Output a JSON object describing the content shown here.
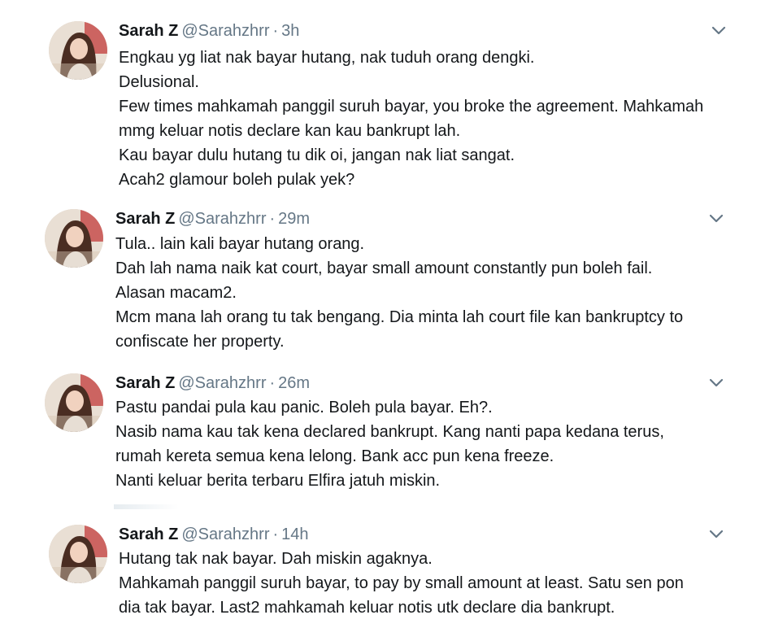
{
  "tweets": [
    {
      "name": "Sarah Z",
      "handle": "@Sarahzhrr",
      "dot": "·",
      "time": "3h",
      "lines": [
        "Engkau yg liat nak bayar hutang, nak tuduh orang dengki.",
        "Delusional.",
        "Few times mahkamah panggil suruh bayar, you broke the agreement. Mahkamah",
        "mmg keluar notis declare kan kau bankrupt lah.",
        "Kau bayar dulu hutang tu dik oi, jangan nak liat sangat.",
        "Acah2 glamour boleh pulak yek?"
      ]
    },
    {
      "name": "Sarah Z",
      "handle": "@Sarahzhrr",
      "dot": "·",
      "time": "29m",
      "lines": [
        "Tula.. lain kali bayar hutang orang.",
        "Dah lah nama naik kat court, bayar small amount constantly  pun boleh fail.",
        "Alasan macam2.",
        "Mcm mana lah orang tu tak bengang. Dia minta lah court file kan bankruptcy to",
        "confiscate her property."
      ]
    },
    {
      "name": "Sarah Z",
      "handle": "@Sarahzhrr",
      "dot": "·",
      "time": "26m",
      "lines": [
        "Pastu pandai pula kau panic. Boleh pula bayar. Eh?.",
        "Nasib nama kau tak kena declared bankrupt. Kang nanti papa kedana terus,",
        "rumah kereta semua kena lelong. Bank acc pun kena freeze.",
        "Nanti keluar berita terbaru Elfira jatuh miskin."
      ]
    },
    {
      "name": "Sarah Z",
      "handle": "@Sarahzhrr",
      "dot": "·",
      "time": "14h",
      "lines": [
        "Hutang tak nak bayar. Dah miskin agaknya.",
        "Mahkamah panggil suruh bayar, to pay by small amount at least. Satu sen pon",
        "dia tak bayar. Last2 mahkamah keluar notis utk declare dia bankrupt."
      ]
    }
  ],
  "icons": {
    "caret": "chevron-down-icon",
    "avatar": "avatar"
  },
  "colors": {
    "text": "#14171a",
    "secondary": "#657786",
    "background": "#ffffff"
  }
}
